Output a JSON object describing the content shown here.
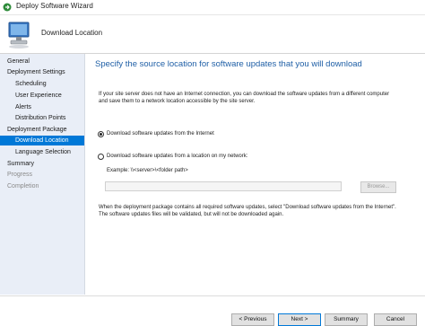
{
  "window": {
    "title": "Deploy Software Wizard",
    "icon": "arrow-right-icon",
    "accent": "#0078d7"
  },
  "banner": {
    "icon": "computer-install-icon",
    "title": "Download Location"
  },
  "sidebar": {
    "items": [
      {
        "label": "General",
        "level": 0,
        "state": "normal"
      },
      {
        "label": "Deployment Settings",
        "level": 0,
        "state": "normal"
      },
      {
        "label": "Scheduling",
        "level": 1,
        "state": "normal"
      },
      {
        "label": "User Experience",
        "level": 1,
        "state": "normal"
      },
      {
        "label": "Alerts",
        "level": 1,
        "state": "normal"
      },
      {
        "label": "Distribution Points",
        "level": 1,
        "state": "normal"
      },
      {
        "label": "Deployment Package",
        "level": 0,
        "state": "normal"
      },
      {
        "label": "Download Location",
        "level": 1,
        "state": "selected"
      },
      {
        "label": "Language Selection",
        "level": 1,
        "state": "normal"
      },
      {
        "label": "Summary",
        "level": 0,
        "state": "normal"
      },
      {
        "label": "Progress",
        "level": 0,
        "state": "dim"
      },
      {
        "label": "Completion",
        "level": 0,
        "state": "dim"
      }
    ]
  },
  "main": {
    "heading": "Specify the source location for software updates that you will download",
    "intro_line1": "If your site server does not have an Internet connection, you can download the software updates from a different computer",
    "intro_line2": "and save them to a network location accessible by the site server.",
    "option_internet": {
      "label": "Download software updates from the Internet",
      "checked": true
    },
    "option_network": {
      "label": "Download software updates from a location on my network:",
      "checked": false
    },
    "example": "Example: \\\\<server>\\<folder path>",
    "path_value": "",
    "browse_label": "Browse...",
    "note_line1": "When the deployment package contains all required software updates, select \"Download  software updates from the Internet\".",
    "note_line2": "The software updates files will be validated, but will not be downloaded again."
  },
  "footer": {
    "previous_label": "< Previous",
    "next_label": "Next >",
    "summary_label": "Summary",
    "cancel_label": "Cancel"
  }
}
